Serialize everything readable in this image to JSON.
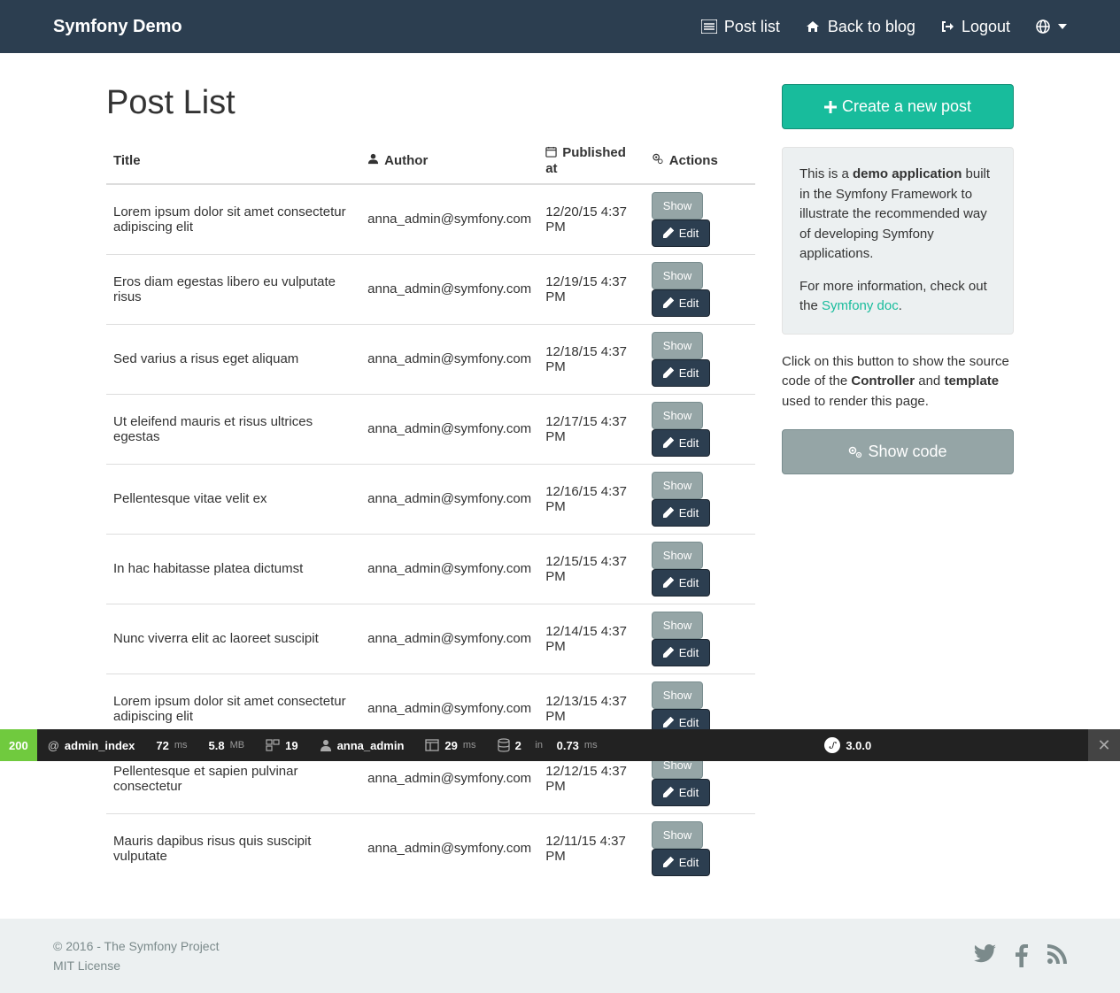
{
  "navbar": {
    "brand": "Symfony Demo",
    "items": [
      {
        "label": "Post list"
      },
      {
        "label": "Back to blog"
      },
      {
        "label": "Logout"
      }
    ]
  },
  "page": {
    "title": "Post List"
  },
  "table": {
    "headers": {
      "title": "Title",
      "author": "Author",
      "published": "Published at",
      "actions": "Actions"
    },
    "rows": [
      {
        "title": "Lorem ipsum dolor sit amet consectetur adipiscing elit",
        "author": "anna_admin@symfony.com",
        "published": "12/20/15 4:37 PM"
      },
      {
        "title": "Eros diam egestas libero eu vulputate risus",
        "author": "anna_admin@symfony.com",
        "published": "12/19/15 4:37 PM"
      },
      {
        "title": "Sed varius a risus eget aliquam",
        "author": "anna_admin@symfony.com",
        "published": "12/18/15 4:37 PM"
      },
      {
        "title": "Ut eleifend mauris et risus ultrices egestas",
        "author": "anna_admin@symfony.com",
        "published": "12/17/15 4:37 PM"
      },
      {
        "title": "Pellentesque vitae velit ex",
        "author": "anna_admin@symfony.com",
        "published": "12/16/15 4:37 PM"
      },
      {
        "title": "In hac habitasse platea dictumst",
        "author": "anna_admin@symfony.com",
        "published": "12/15/15 4:37 PM"
      },
      {
        "title": "Nunc viverra elit ac laoreet suscipit",
        "author": "anna_admin@symfony.com",
        "published": "12/14/15 4:37 PM"
      },
      {
        "title": "Lorem ipsum dolor sit amet consectetur adipiscing elit",
        "author": "anna_admin@symfony.com",
        "published": "12/13/15 4:37 PM"
      },
      {
        "title": "Pellentesque et sapien pulvinar consectetur",
        "author": "anna_admin@symfony.com",
        "published": "12/12/15 4:37 PM"
      },
      {
        "title": "Mauris dapibus risus quis suscipit vulputate",
        "author": "anna_admin@symfony.com",
        "published": "12/11/15 4:37 PM"
      }
    ],
    "show_label": "Show",
    "edit_label": "Edit"
  },
  "sidebar": {
    "create_label": "Create a new post",
    "well_html": {
      "p1_before": "This is a ",
      "p1_strong": "demo application",
      "p1_after": " built in the Symfony Framework to illustrate the recommended way of developing Symfony applications.",
      "p2_before": "For more information, check out the ",
      "p2_link": "Symfony doc",
      "p2_after": "."
    },
    "info_before": "Click on this button to show the source code of the ",
    "info_strong1": "Controller",
    "info_mid": " and ",
    "info_strong2": "template",
    "info_after": " used to render this page.",
    "show_code_label": "Show code"
  },
  "footer": {
    "copyright": "© 2016 - The Symfony Project",
    "license": "MIT License"
  },
  "debug": {
    "status": "200",
    "route_prefix": "@",
    "route": "admin_index",
    "time": "72",
    "time_unit": "ms",
    "mem": "5.8",
    "mem_unit": "MB",
    "forms": "19",
    "user": "anna_admin",
    "panel_time": "29",
    "panel_unit": "ms",
    "db_count": "2",
    "db_in": "in",
    "db_time": "0.73",
    "db_unit": "ms",
    "sf_version": "3.0.0"
  }
}
